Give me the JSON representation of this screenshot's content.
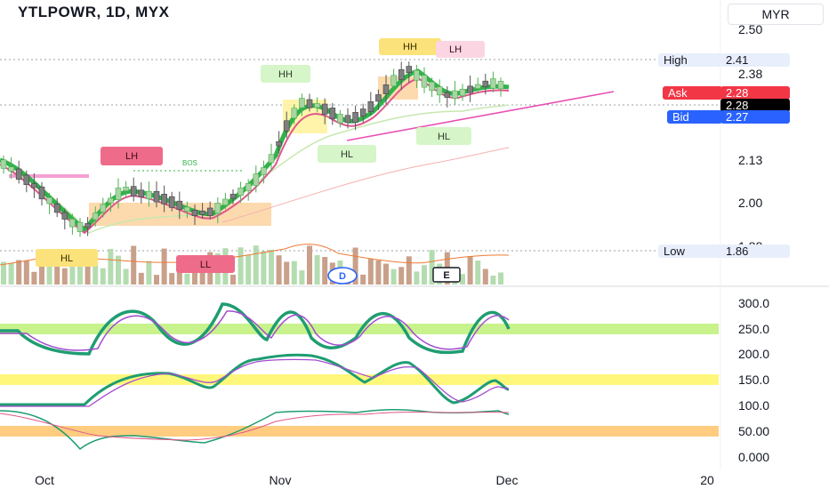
{
  "header": {
    "symbol_title": "YTLPOWR, 1D, MYX",
    "currency": "MYR"
  },
  "price_axis": {
    "ticks": [
      "2.50",
      "2.38",
      "2.13",
      "2.00",
      "1.88"
    ],
    "high_label": "High",
    "high_value": "2.41",
    "ask_label": "Ask",
    "ask_value": "2.28",
    "last_value": "2.28",
    "bid_label": "Bid",
    "bid_value": "2.27",
    "low_label": "Low",
    "low_value": "1.86"
  },
  "osc_axis": {
    "ticks": [
      "300.0",
      "250.0",
      "200.0",
      "150.0",
      "100.0",
      "50.00",
      "0.000"
    ]
  },
  "time_axis": {
    "ticks": [
      "Oct",
      "Nov",
      "Dec",
      "20"
    ]
  },
  "annotations": {
    "hh1": "HH",
    "hh2": "HH",
    "lh1": "LH",
    "lh2": "LH",
    "hl1": "HL",
    "hl2": "HL",
    "hl3": "HL",
    "ll": "LL",
    "bos": "BOS"
  },
  "event_badges": {
    "dividend": "D",
    "earnings": "E"
  },
  "colors": {
    "up": "#a9d4a4",
    "down": "#7e7e7e",
    "ribbon_up": "#31b24a",
    "ribbon_down": "#e0578c",
    "trendline": "#e84fb4",
    "zone_yellow": "#fff3a0",
    "zone_orange": "#fcd4a0",
    "ask": "#f23645",
    "bid": "#2962ff",
    "osc_green": "#c8f28c",
    "osc_yellow": "#fff77a",
    "osc_orange": "#ffcc80"
  }
}
